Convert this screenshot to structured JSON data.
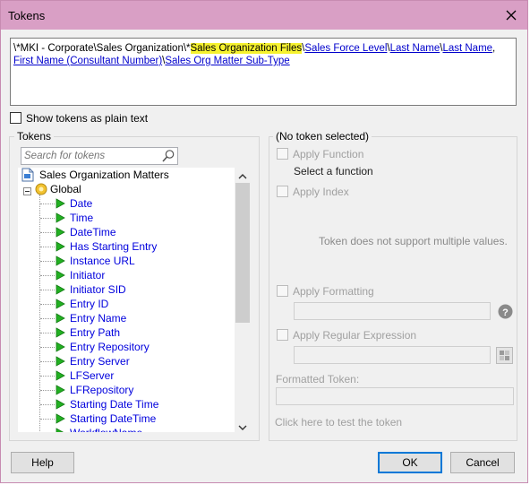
{
  "window": {
    "title": "Tokens"
  },
  "path": {
    "segments": [
      {
        "text": "\\*MKI - Corporate\\Sales Organization\\*",
        "style": "plain"
      },
      {
        "text": "Sales Organization Files",
        "style": "highlight"
      },
      {
        "text": "\\",
        "style": "plain"
      },
      {
        "text": "Sales Force Level",
        "style": "token"
      },
      {
        "text": "\\",
        "style": "plain"
      },
      {
        "text": "Last Name",
        "style": "token"
      },
      {
        "text": "\\",
        "style": "plain"
      },
      {
        "text": "Last Name",
        "style": "token"
      },
      {
        "text": ", ",
        "style": "plain"
      },
      {
        "text": "First Name (Consultant Number)",
        "style": "token"
      },
      {
        "text": "\\",
        "style": "plain"
      },
      {
        "text": "Sales Org Matter Sub-Type",
        "style": "token"
      }
    ]
  },
  "show_plain_label": "Show tokens as plain text",
  "tokens_panel": {
    "title": "Tokens",
    "search_placeholder": "Search for tokens",
    "root": "Sales Organization Matters",
    "group": "Global",
    "items": [
      "Date",
      "Time",
      "DateTime",
      "Has Starting Entry",
      "Instance URL",
      "Initiator",
      "Initiator SID",
      "Entry ID",
      "Entry Name",
      "Entry Path",
      "Entry Repository",
      "Entry Server",
      "LFServer",
      "LFRepository",
      "Starting Date Time",
      "Starting DateTime",
      "WorkflowName"
    ]
  },
  "details_panel": {
    "title": "(No token selected)",
    "apply_function": "Apply Function",
    "select_function": "Select a function",
    "apply_index": "Apply Index",
    "no_multiple": "Token does not support multiple values.",
    "apply_formatting": "Apply Formatting",
    "apply_regex": "Apply Regular Expression",
    "formatted_token_label": "Formatted Token:",
    "test_link": "Click here to test the token"
  },
  "buttons": {
    "help": "Help",
    "ok": "OK",
    "cancel": "Cancel"
  },
  "colors": {
    "titlebar": "#d99fc5",
    "link": "#0000cc",
    "highlight": "#f6f22f",
    "play_icon": "#22b022"
  }
}
